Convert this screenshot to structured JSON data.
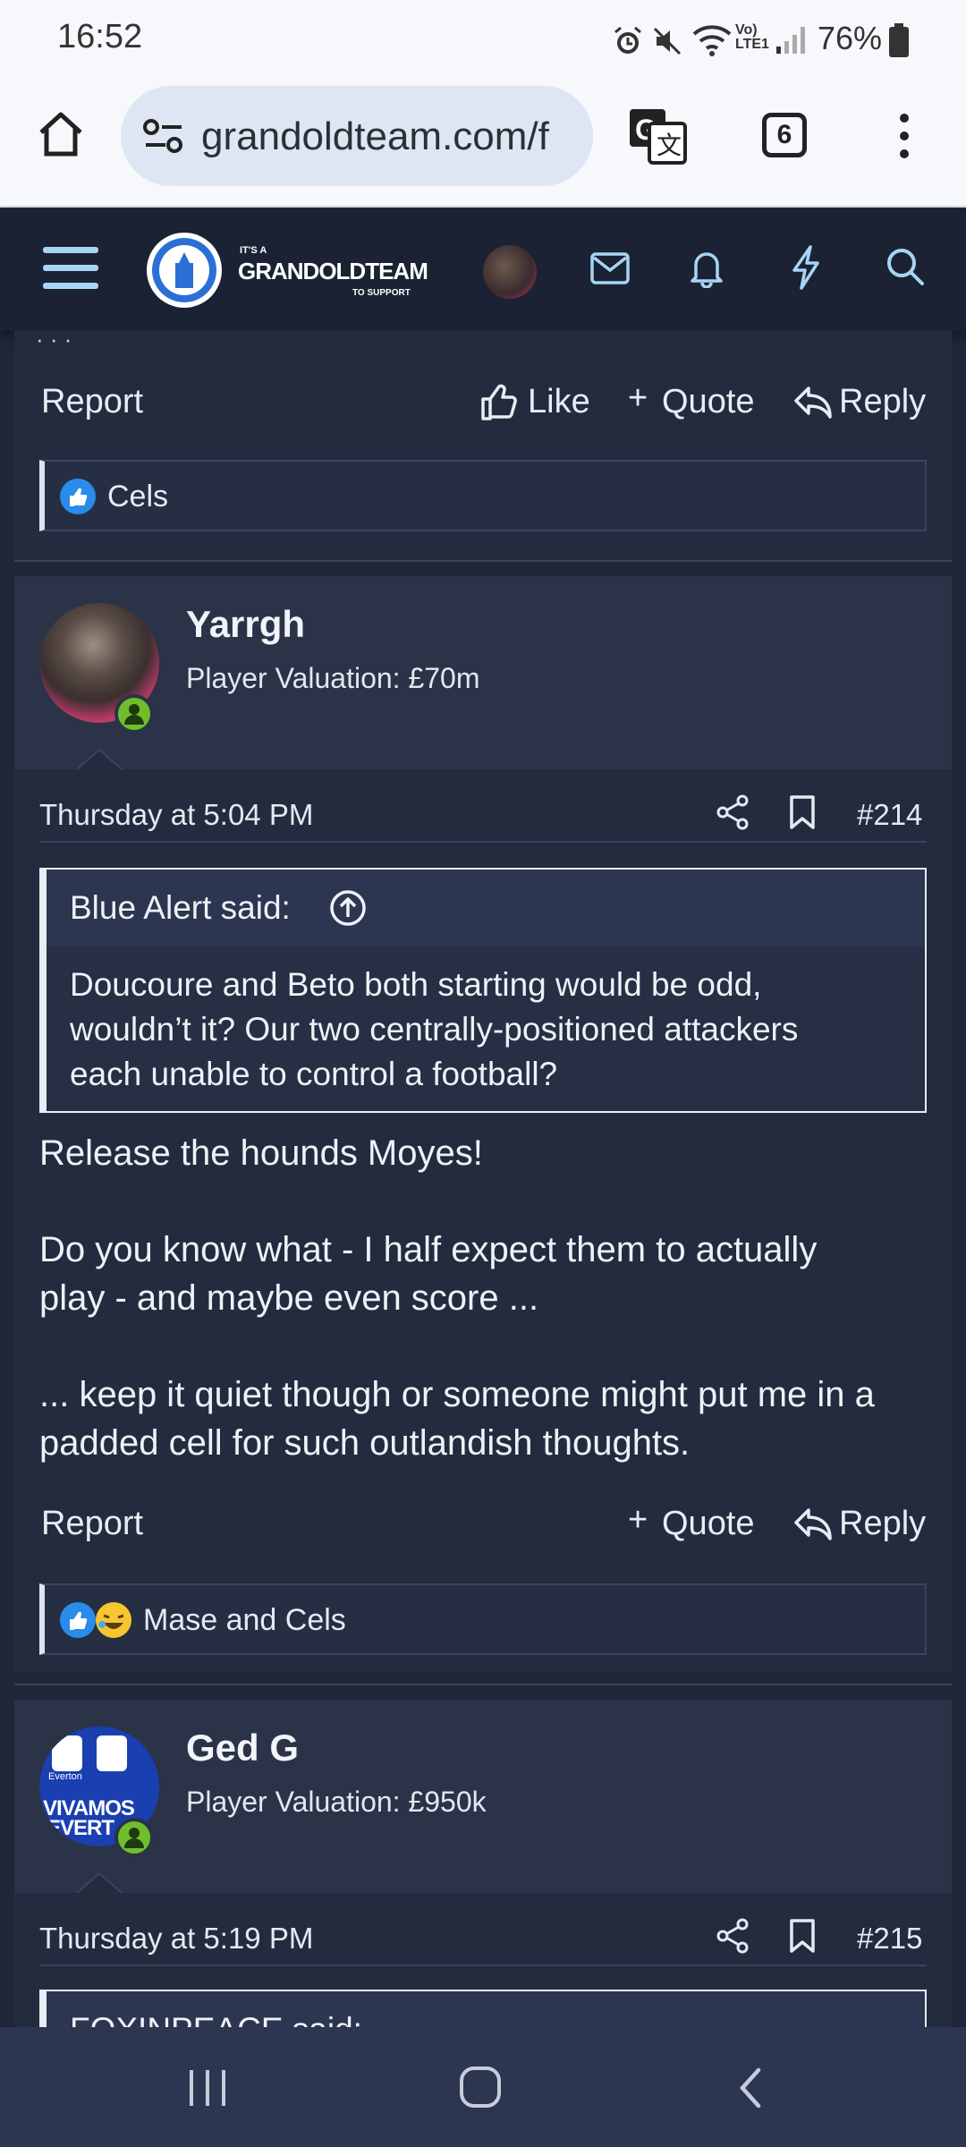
{
  "status_bar": {
    "time": "16:52",
    "battery": "76%",
    "network_label": "Vo) LTE1"
  },
  "browser": {
    "url": "grandoldteam.com/f",
    "tab_count": "6"
  },
  "site": {
    "logo_small": "IT'S A",
    "logo_name": "GRANDOLDTEAM",
    "logo_sub": "TO SUPPORT"
  },
  "prev_post": {
    "actions": {
      "report": "Report",
      "like": "Like",
      "quote": "Quote",
      "reply": "Reply"
    },
    "reactions": "Cels"
  },
  "post1": {
    "username": "Yarrgh",
    "valuation": "Player Valuation: £70m",
    "date": "Thursday at 5:04 PM",
    "number": "#214",
    "quote_author": "Blue Alert said:",
    "quote_lines": [
      "Doucoure and Beto both starting would be odd,",
      "wouldn’t it? Our two centrally-positioned attackers",
      "each unable to control a football?"
    ],
    "body_lines": [
      "Release the hounds Moyes!",
      "",
      "Do you know what - I half expect them to actually",
      "play - and maybe even score ...",
      "",
      "... keep it quiet though or someone might put me in a",
      "padded cell for such outlandish thoughts."
    ],
    "actions": {
      "report": "Report",
      "quote": "Quote",
      "reply": "Reply"
    },
    "reactions": "Mase and Cels"
  },
  "post2": {
    "username": "Ged G",
    "valuation": "Player Valuation: £950k",
    "date": "Thursday at 5:19 PM",
    "number": "#215",
    "quote_author": "FOXINPEACE said:",
    "avatar_text_1": "Everton",
    "avatar_text_2": "VIVAMOS",
    "avatar_text_3": "EVERT"
  },
  "colors": {
    "page_bg": "#1f2638",
    "header_bg": "#1a2233",
    "accent_blue": "#2b6fd6",
    "online_green": "#6fbf2a"
  }
}
